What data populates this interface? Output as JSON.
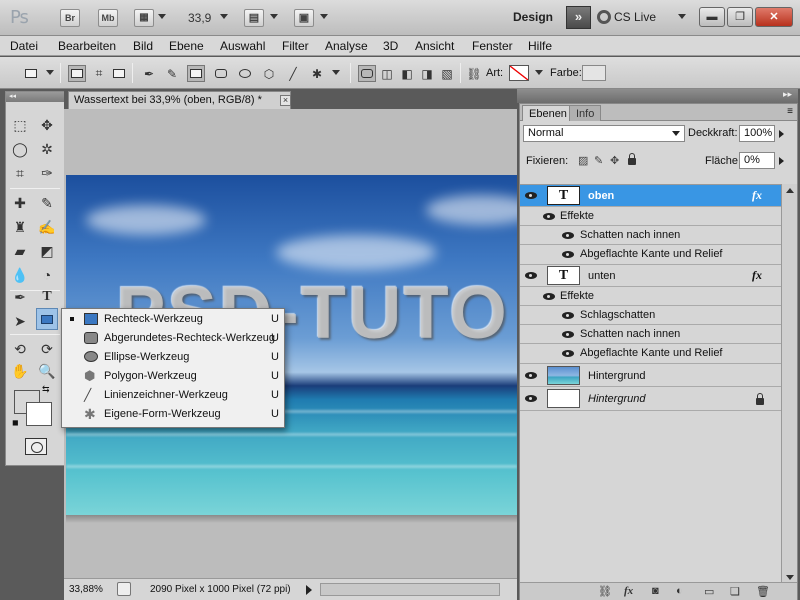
{
  "app": {
    "logo": "Ps",
    "bridge_label": "Br",
    "minibridge_label": "Mb",
    "zoom_value": "33,9",
    "workspace_label": "Design",
    "workspace_more": "»",
    "cslive_label": "CS Live"
  },
  "menu": [
    "Datei",
    "Bearbeiten",
    "Bild",
    "Ebene",
    "Auswahl",
    "Filter",
    "Analyse",
    "3D",
    "Ansicht",
    "Fenster",
    "Hilfe"
  ],
  "options": {
    "art_label": "Art:",
    "farbe_label": "Farbe:"
  },
  "document": {
    "tab_title": "Wassertext bei 33,9% (oben, RGB/8) *",
    "tab_close": "×",
    "canvas_text": "PSD-TUTO",
    "status_zoom": "33,88%",
    "status_info": "2090 Pixel x 1000 Pixel (72 ppi)"
  },
  "flyout": {
    "items": [
      {
        "label": "Rechteck-Werkzeug",
        "shortcut": "U",
        "icon": "rectangle-tool-icon",
        "active": true
      },
      {
        "label": "Abgerundetes-Rechteck-Werkzeug",
        "shortcut": "U",
        "icon": "rounded-rectangle-tool-icon"
      },
      {
        "label": "Ellipse-Werkzeug",
        "shortcut": "U",
        "icon": "ellipse-tool-icon"
      },
      {
        "label": "Polygon-Werkzeug",
        "shortcut": "U",
        "icon": "polygon-tool-icon"
      },
      {
        "label": "Linienzeichner-Werkzeug",
        "shortcut": "U",
        "icon": "line-tool-icon"
      },
      {
        "label": "Eigene-Form-Werkzeug",
        "shortcut": "U",
        "icon": "custom-shape-tool-icon"
      }
    ]
  },
  "panel": {
    "tabs": [
      "Ebenen",
      "Info"
    ],
    "blend_mode": "Normal",
    "opacity_label": "Deckkraft:",
    "opacity_value": "100%",
    "lock_label": "Fixieren:",
    "fill_label": "Fläche:",
    "fill_value": "0%",
    "layers": {
      "oben": {
        "name": "oben",
        "thumb": "T",
        "fx": "fx",
        "effects_label": "Effekte",
        "effects": [
          "Schatten nach innen",
          "Abgeflachte Kante und Relief"
        ]
      },
      "unten": {
        "name": "unten",
        "thumb": "T",
        "fx": "fx",
        "effects_label": "Effekte",
        "effects": [
          "Schlagschatten",
          "Schatten nach innen",
          "Abgeflachte Kante und Relief"
        ]
      },
      "hintergrund_image": {
        "name": "Hintergrund"
      },
      "hintergrund_base": {
        "name": "Hintergrund"
      }
    },
    "bottom_icons": [
      "link-layers-icon",
      "fx-icon",
      "mask-icon",
      "adjustment-icon",
      "folder-icon",
      "new-layer-icon",
      "trash-icon"
    ]
  },
  "colors": {
    "selection": "#3996e4",
    "ui_bg": "#d6d6d6",
    "close_red": "#c0392b"
  }
}
